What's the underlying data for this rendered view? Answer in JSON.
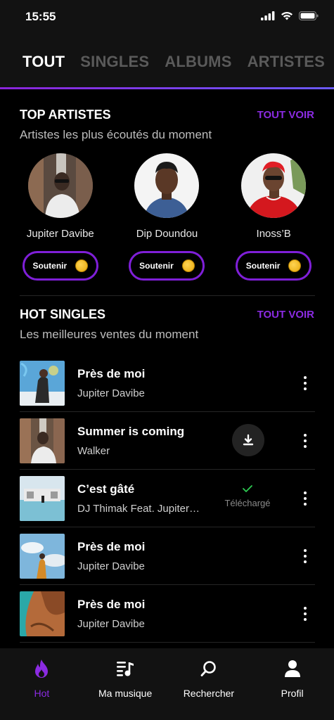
{
  "status": {
    "time": "15:55"
  },
  "tabs": [
    "TOUT",
    "SINGLES",
    "ALBUMS",
    "ARTISTES"
  ],
  "top_artists": {
    "title": "TOP ARTISTES",
    "see_all": "TOUT VOIR",
    "subtitle": "Artistes les plus écoutés du moment",
    "support_label": "Soutenir",
    "items": [
      {
        "name": "Jupiter Davibe"
      },
      {
        "name": "Dip Doundou"
      },
      {
        "name": "Inoss’B"
      }
    ]
  },
  "hot_singles": {
    "title": "HOT SINGLES",
    "see_all": "TOUT VOIR",
    "subtitle": "Les meilleures ventes du moment",
    "downloaded_label": "Téléchargé",
    "items": [
      {
        "title": "Près de moi",
        "artist": "Jupiter Davibe",
        "state": "none"
      },
      {
        "title": "Summer is coming",
        "artist": "Walker",
        "state": "download"
      },
      {
        "title": "C’est gâté",
        "artist": "DJ Thimak Feat. Jupiter Davibe",
        "state": "downloaded"
      },
      {
        "title": "Près de moi",
        "artist": "Jupiter Davibe",
        "state": "none"
      },
      {
        "title": "Près de moi",
        "artist": "Jupiter Davibe",
        "state": "none"
      }
    ]
  },
  "nav": [
    {
      "label": "Hot",
      "icon": "flame-icon"
    },
    {
      "label": "Ma musique",
      "icon": "music-list-icon"
    },
    {
      "label": "Rechercher",
      "icon": "search-icon"
    },
    {
      "label": "Profil",
      "icon": "profile-icon"
    }
  ],
  "colors": {
    "accent": "#8b2be2",
    "background": "#000000",
    "bar": "#121212",
    "coin": "#f2b81c"
  }
}
